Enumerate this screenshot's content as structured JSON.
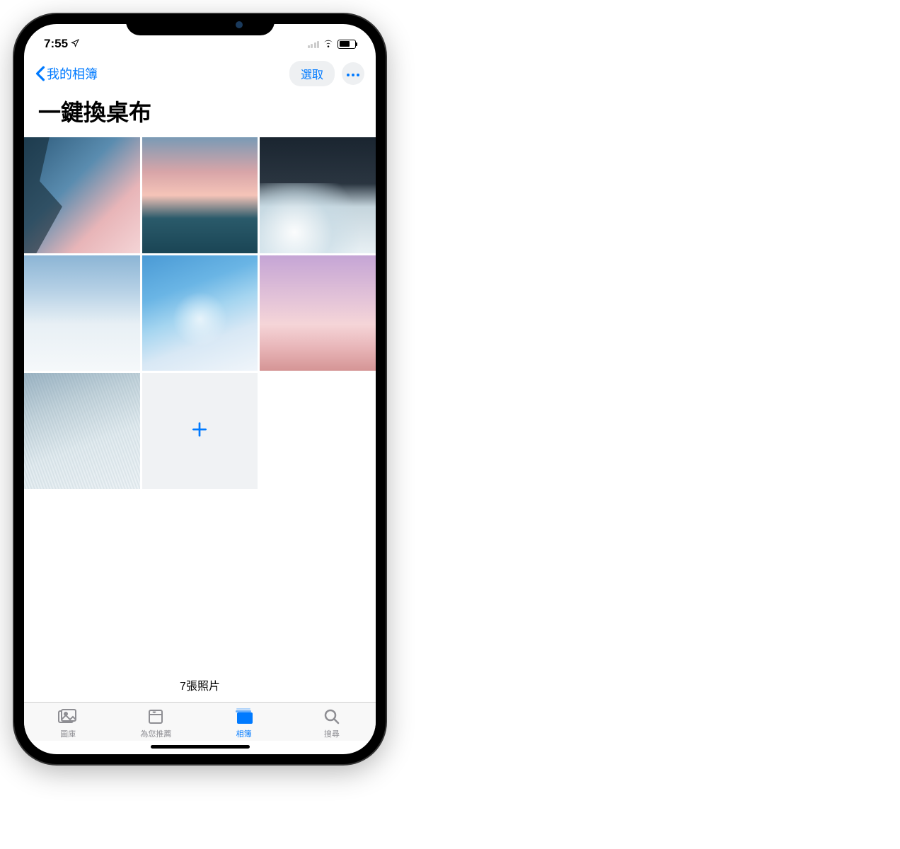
{
  "statusBar": {
    "time": "7:55"
  },
  "nav": {
    "backLabel": "我的相簿",
    "selectLabel": "選取"
  },
  "album": {
    "title": "一鍵換桌布",
    "photoCount": "7張照片"
  },
  "tabs": {
    "library": "圖庫",
    "forYou": "為您推薦",
    "albums": "相簿",
    "search": "搜尋"
  }
}
